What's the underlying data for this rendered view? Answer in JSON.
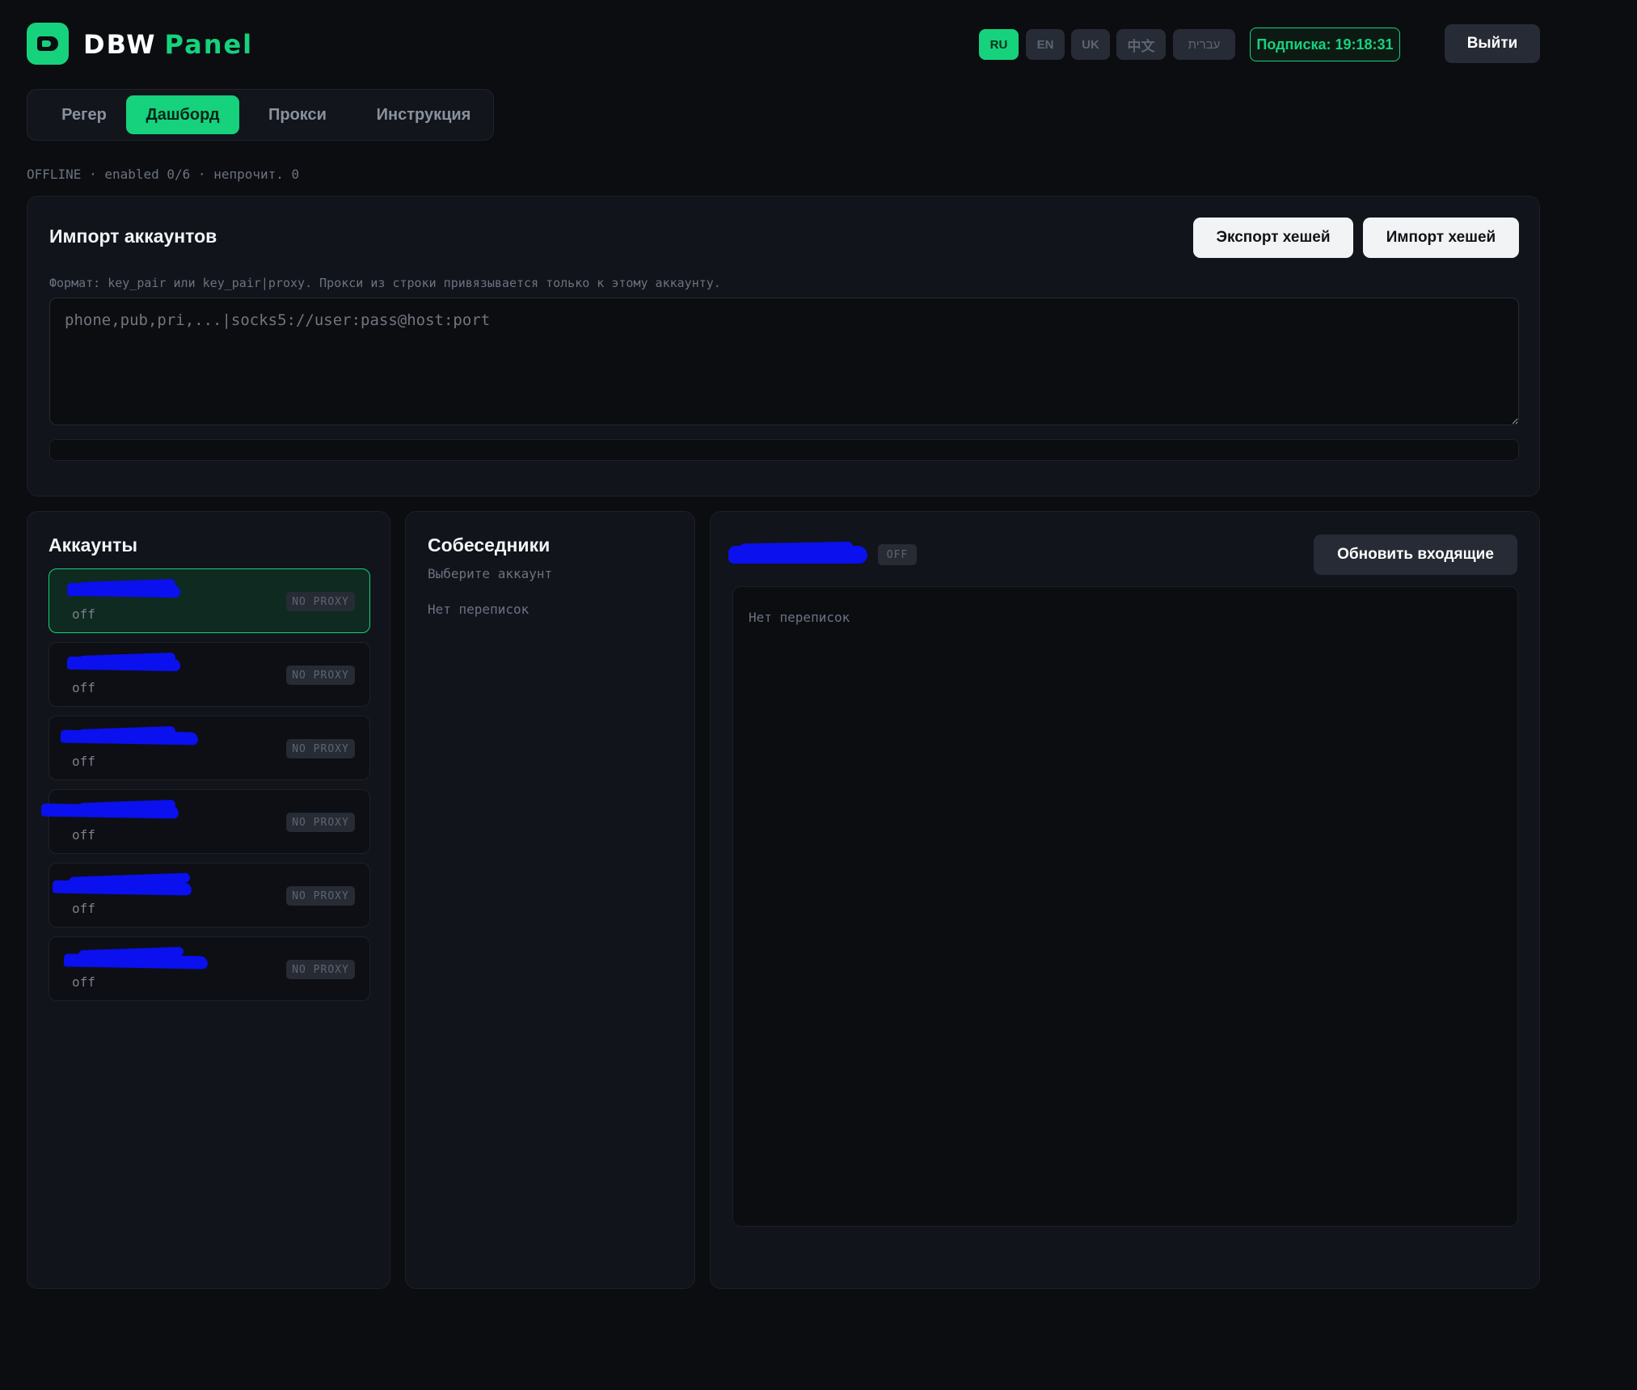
{
  "header": {
    "brand_primary": "DBW",
    "brand_secondary": "Panel",
    "languages": [
      "RU",
      "EN",
      "UK",
      "中文",
      "עברית"
    ],
    "active_language": "RU",
    "subscription": "Подписка: 19:18:31",
    "logout": "Выйти"
  },
  "tabs": [
    {
      "label": "Регер",
      "active": false
    },
    {
      "label": "Дашборд",
      "active": true
    },
    {
      "label": "Прокси",
      "active": false
    },
    {
      "label": "Инструкция",
      "active": false
    }
  ],
  "status_line": "OFFLINE · enabled 0/6 · непрочит. 0",
  "import": {
    "title": "Импорт аккаунтов",
    "export_button": "Экспорт хешей",
    "import_button": "Импорт хешей",
    "hint": "Формат: key_pair или key_pair|proxy. Прокси из строки привязывается только к этому аккаунту.",
    "placeholder": "phone,pub,pri,...|socks5://user:pass@host:port",
    "progress": 0
  },
  "accounts": {
    "title": "Аккаунты",
    "items": [
      {
        "state": "off",
        "proxy": "NO PROXY",
        "selected": true
      },
      {
        "state": "off",
        "proxy": "NO PROXY",
        "selected": false
      },
      {
        "state": "off",
        "proxy": "NO PROXY",
        "selected": false
      },
      {
        "state": "off",
        "proxy": "NO PROXY",
        "selected": false
      },
      {
        "state": "off",
        "proxy": "NO PROXY",
        "selected": false
      },
      {
        "state": "off",
        "proxy": "NO PROXY",
        "selected": false
      }
    ]
  },
  "contacts": {
    "title": "Собеседники",
    "subtitle": "Выберите аккаунт",
    "empty": "Нет переписок"
  },
  "chat": {
    "status_badge": "OFF",
    "refresh_button": "Обновить входящие",
    "empty": "Нет переписок"
  },
  "colors": {
    "accent": "#16d27c",
    "background": "#0b0d11",
    "panel": "#11141a",
    "redaction": "#0a10ee"
  }
}
